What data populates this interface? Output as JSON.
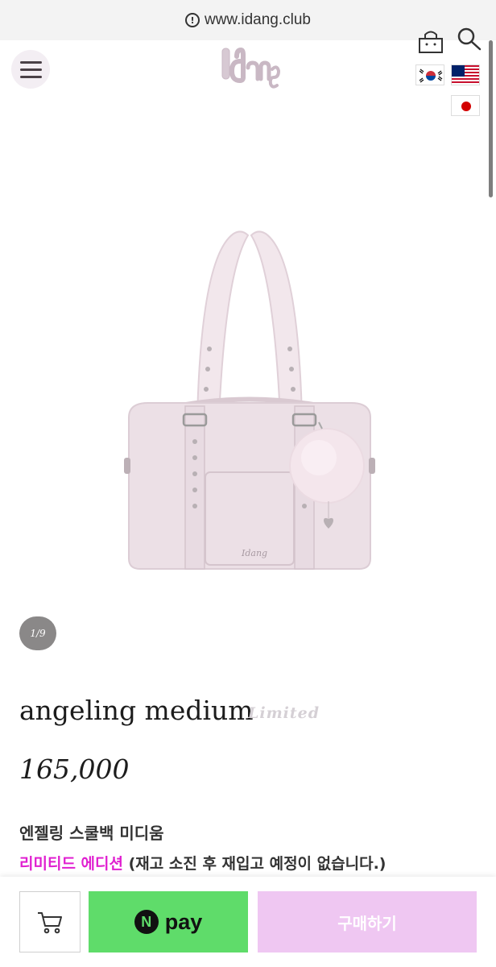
{
  "browser": {
    "url": "www.idang.club"
  },
  "header": {
    "logo_text": "Idang",
    "languages": [
      "Korean",
      "English",
      "Japanese"
    ]
  },
  "gallery": {
    "pager": "1/9"
  },
  "product": {
    "name": "angeling medium",
    "badge": "Limited",
    "price": "165,000",
    "name_kr": "엔젤링 스쿨백 미디움",
    "limited_label": "리미티드 에디션",
    "limited_note": "(재고 소진 후 재입고 예정이 없습니다.)"
  },
  "actions": {
    "npay_label": "pay",
    "buy_label": "구매하기"
  },
  "colors": {
    "npay": "#5fdc6a",
    "buy": "#efc7f2",
    "highlight": "#e01fd0",
    "bag": "#ece0e6"
  }
}
